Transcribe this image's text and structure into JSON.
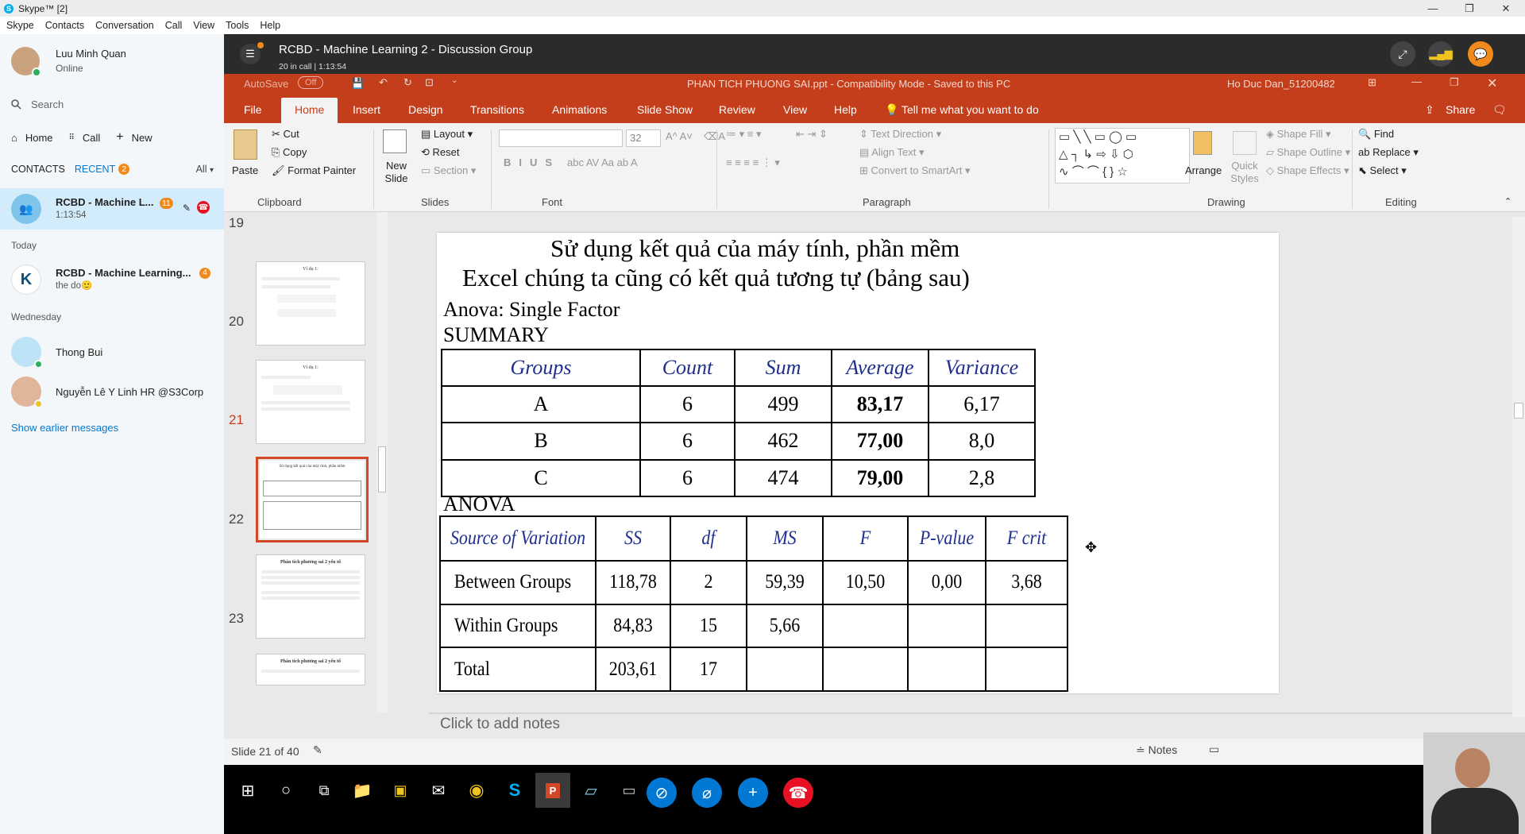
{
  "window": {
    "title": "Skype™ [2]",
    "app_icon": "skype-icon"
  },
  "menu": [
    "Skype",
    "Contacts",
    "Conversation",
    "Call",
    "View",
    "Tools",
    "Help"
  ],
  "profile": {
    "name": "Luu Minh Quan",
    "status": "Online"
  },
  "sidebar": {
    "search_placeholder": "Search",
    "nav": {
      "home": "Home",
      "call": "Call",
      "new": "New"
    },
    "tabs": {
      "contacts": "CONTACTS",
      "recent": "RECENT",
      "recent_badge": "2",
      "all": "All"
    },
    "active": {
      "name": "RCBD - Machine L...",
      "badge": "11",
      "sub": "1:13:54"
    },
    "today_label": "Today",
    "today_item": {
      "name": "RCBD - Machine Learning...",
      "badge": "4",
      "sub": "the do"
    },
    "wednesday_label": "Wednesday",
    "contacts": [
      {
        "name": "Thong Bui"
      },
      {
        "name": "Nguyễn Lê Y Linh HR @S3Corp"
      }
    ],
    "show_earlier": "Show earlier messages"
  },
  "call": {
    "title": "RCBD - Machine Learning 2 - Discussion Group",
    "sub": "20 in call | 1:13:54"
  },
  "ppt": {
    "autosave": "AutoSave",
    "autosave_state": "Off",
    "file_title": "PHAN TICH PHUONG SAI.ppt  -  Compatibility Mode  -  Saved to this PC",
    "user": "Ho Duc Dan_51200482",
    "tabs": [
      "File",
      "Home",
      "Insert",
      "Design",
      "Transitions",
      "Animations",
      "Slide Show",
      "Review",
      "View",
      "Help"
    ],
    "tellme": "Tell me what you want to do",
    "share": "Share",
    "ribbon": {
      "paste": "Paste",
      "cut": "Cut",
      "copy": "Copy",
      "format_painter": "Format Painter",
      "clipboard": "Clipboard",
      "new_slide": "New Slide",
      "layout": "Layout",
      "reset": "Reset",
      "section": "Section",
      "slides": "Slides",
      "font_size": "32",
      "font": "Font",
      "text_direction": "Text Direction",
      "align_text": "Align Text",
      "convert_smartart": "Convert to SmartArt",
      "paragraph": "Paragraph",
      "arrange": "Arrange",
      "quick_styles": "Quick Styles",
      "shape_fill": "Shape Fill",
      "shape_outline": "Shape Outline",
      "shape_effects": "Shape Effects",
      "drawing": "Drawing",
      "find": "Find",
      "replace": "Replace",
      "select": "Select",
      "editing": "Editing"
    },
    "thumbs": [
      {
        "num": "19",
        "title": "Ví dụ 1:"
      },
      {
        "num": "20",
        "title": "Ví dụ 1:"
      },
      {
        "num": "21",
        "title": "Sử dụng kết quả của máy tính, phần mềm"
      },
      {
        "num": "22",
        "title": "Phân tích phương sai 2 yếu tố"
      },
      {
        "num": "23",
        "title": "Phân tích phương sai 2 yếu tố"
      }
    ],
    "slide": {
      "heading1": "Sử dụng kết quả của máy tính, phần mềm",
      "heading2": "Excel chúng ta cũng có kết quả tương tự (bảng sau)",
      "anova_single": "Anova: Single Factor",
      "summary": "SUMMARY",
      "summary_headers": [
        "Groups",
        "Count",
        "Sum",
        "Average",
        "Variance"
      ],
      "summary_rows": [
        [
          "A",
          "6",
          "499",
          "83,17",
          "6,17"
        ],
        [
          "B",
          "6",
          "462",
          "77,00",
          "8,0"
        ],
        [
          "C",
          "6",
          "474",
          "79,00",
          "2,8"
        ]
      ],
      "anova": "ANOVA",
      "anova_headers": [
        "Source of Variation",
        "SS",
        "df",
        "MS",
        "F",
        "P-value",
        "F crit"
      ],
      "anova_rows": [
        [
          "Between Groups",
          "118,78",
          "2",
          "59,39",
          "10,50",
          "0,00",
          "3,68"
        ],
        [
          "Within Groups",
          "84,83",
          "15",
          "5,66",
          "",
          "",
          ""
        ],
        [
          "Total",
          "203,61",
          "17",
          "",
          "",
          "",
          ""
        ]
      ]
    },
    "notes_placeholder": "Click to add notes",
    "status": {
      "slide_info": "Slide 21 of 40",
      "notes": "Notes"
    }
  },
  "colors": {
    "ppt_accent": "#c43e1c",
    "skype_blue": "#00aff0",
    "call_end": "#e81123",
    "call_ctrl": "#0078d4"
  }
}
